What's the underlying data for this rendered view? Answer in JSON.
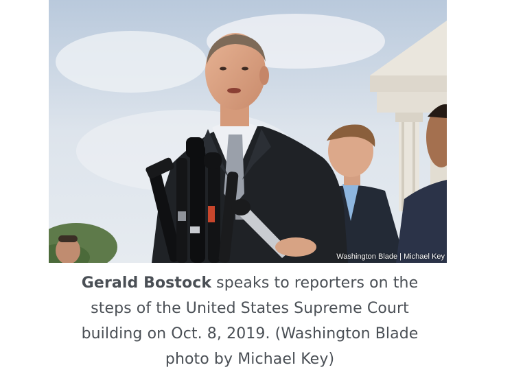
{
  "photo": {
    "credit": "Washington Blade | Michael Key"
  },
  "caption": {
    "name": "Gerald Bostock",
    "text": " speaks to reporters on the steps of the United States Supreme Court building on Oct. 8, 2019. (Washington Blade photo by Michael Key)"
  },
  "colors": {
    "caption_text": "#4a4f55",
    "sky": "#cfd9e6",
    "suit": "#1f2226"
  }
}
